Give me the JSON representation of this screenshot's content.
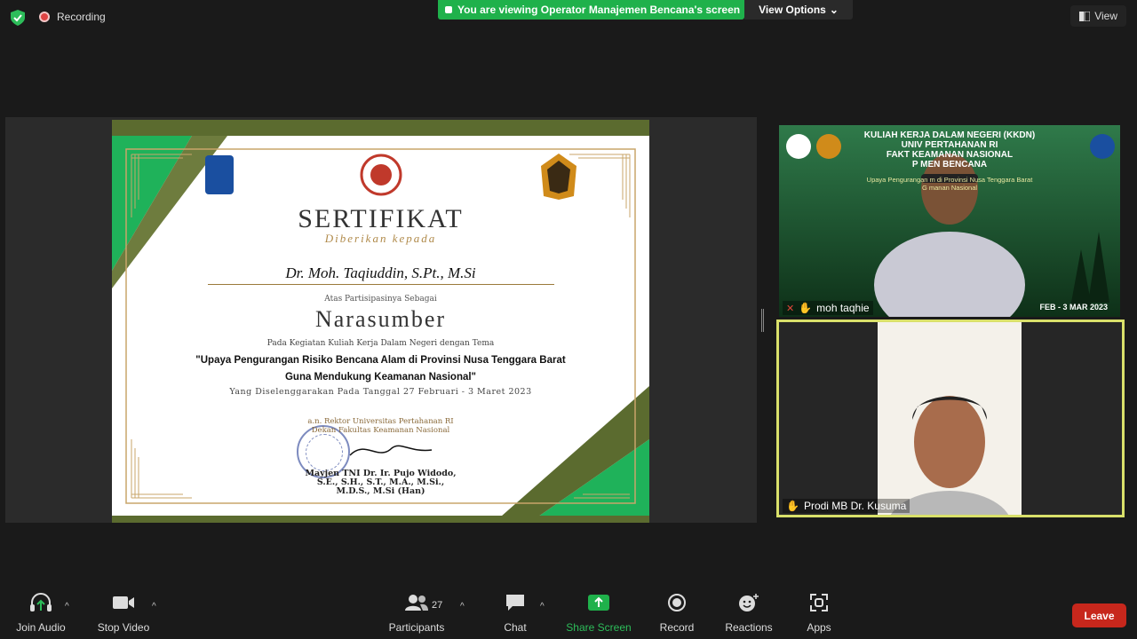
{
  "top": {
    "recording_label": "Recording",
    "viewing_banner": "You are viewing Operator Manajemen Bencana's screen",
    "view_options": "View Options",
    "view_button": "View"
  },
  "certificate": {
    "title": "SERTIFIKAT",
    "subtitle": "Diberikan kepada",
    "recipient": "Dr. Moh. Taqiuddin, S.Pt., M.Si",
    "as_label": "Atas Partisipasinya Sebagai",
    "role": "Narasumber",
    "event_intro": "Pada Kegiatan Kuliah Kerja Dalam Negeri dengan Tema",
    "theme_line1": "\"Upaya Pengurangan Risiko Bencana Alam di Provinsi Nusa Tenggara Barat",
    "theme_line2": "Guna Mendukung Keamanan Nasional\"",
    "date": "Yang Diselenggarakan Pada Tanggal 27 Februari - 3 Maret 2023",
    "sign_line1": "a.n. Rektor Universitas Pertahanan RI",
    "sign_line2": "Dekan Fakultas Keamanan Nasional",
    "signer_line1": "Mayjen TNI Dr. Ir. Pujo Widodo,",
    "signer_line2": "S.E., S.H., S.T., M.A., M.Si.,",
    "signer_line3": "M.D.S., M.Si (Han)"
  },
  "participants": [
    {
      "name": "moh taqhie",
      "banner_title1": "KULIAH KERJA DALAM NEGERI (KKDN)",
      "banner_title2": "UNIV        PERTAHANAN RI",
      "banner_title3": "FAKT        KEAMANAN NASIONAL",
      "banner_title4": "P          MEN BENCANA",
      "banner_sub1": "Upaya Pengurangan           m di Provinsi Nusa Tenggara Barat",
      "banner_sub2": "G           manan Nasional",
      "banner_date": "FEB - 3 MAR 2023"
    },
    {
      "name": "Prodi MB Dr. Kusuma"
    }
  ],
  "toolbar": {
    "join_audio": "Join Audio",
    "stop_video": "Stop Video",
    "participants": "Participants",
    "participants_count": "27",
    "chat": "Chat",
    "share_screen": "Share Screen",
    "record": "Record",
    "reactions": "Reactions",
    "apps": "Apps",
    "leave": "Leave"
  },
  "colors": {
    "share_green": "#1fb14b",
    "leave_red": "#c7271c",
    "active_speaker_border": "#d9e06a"
  }
}
